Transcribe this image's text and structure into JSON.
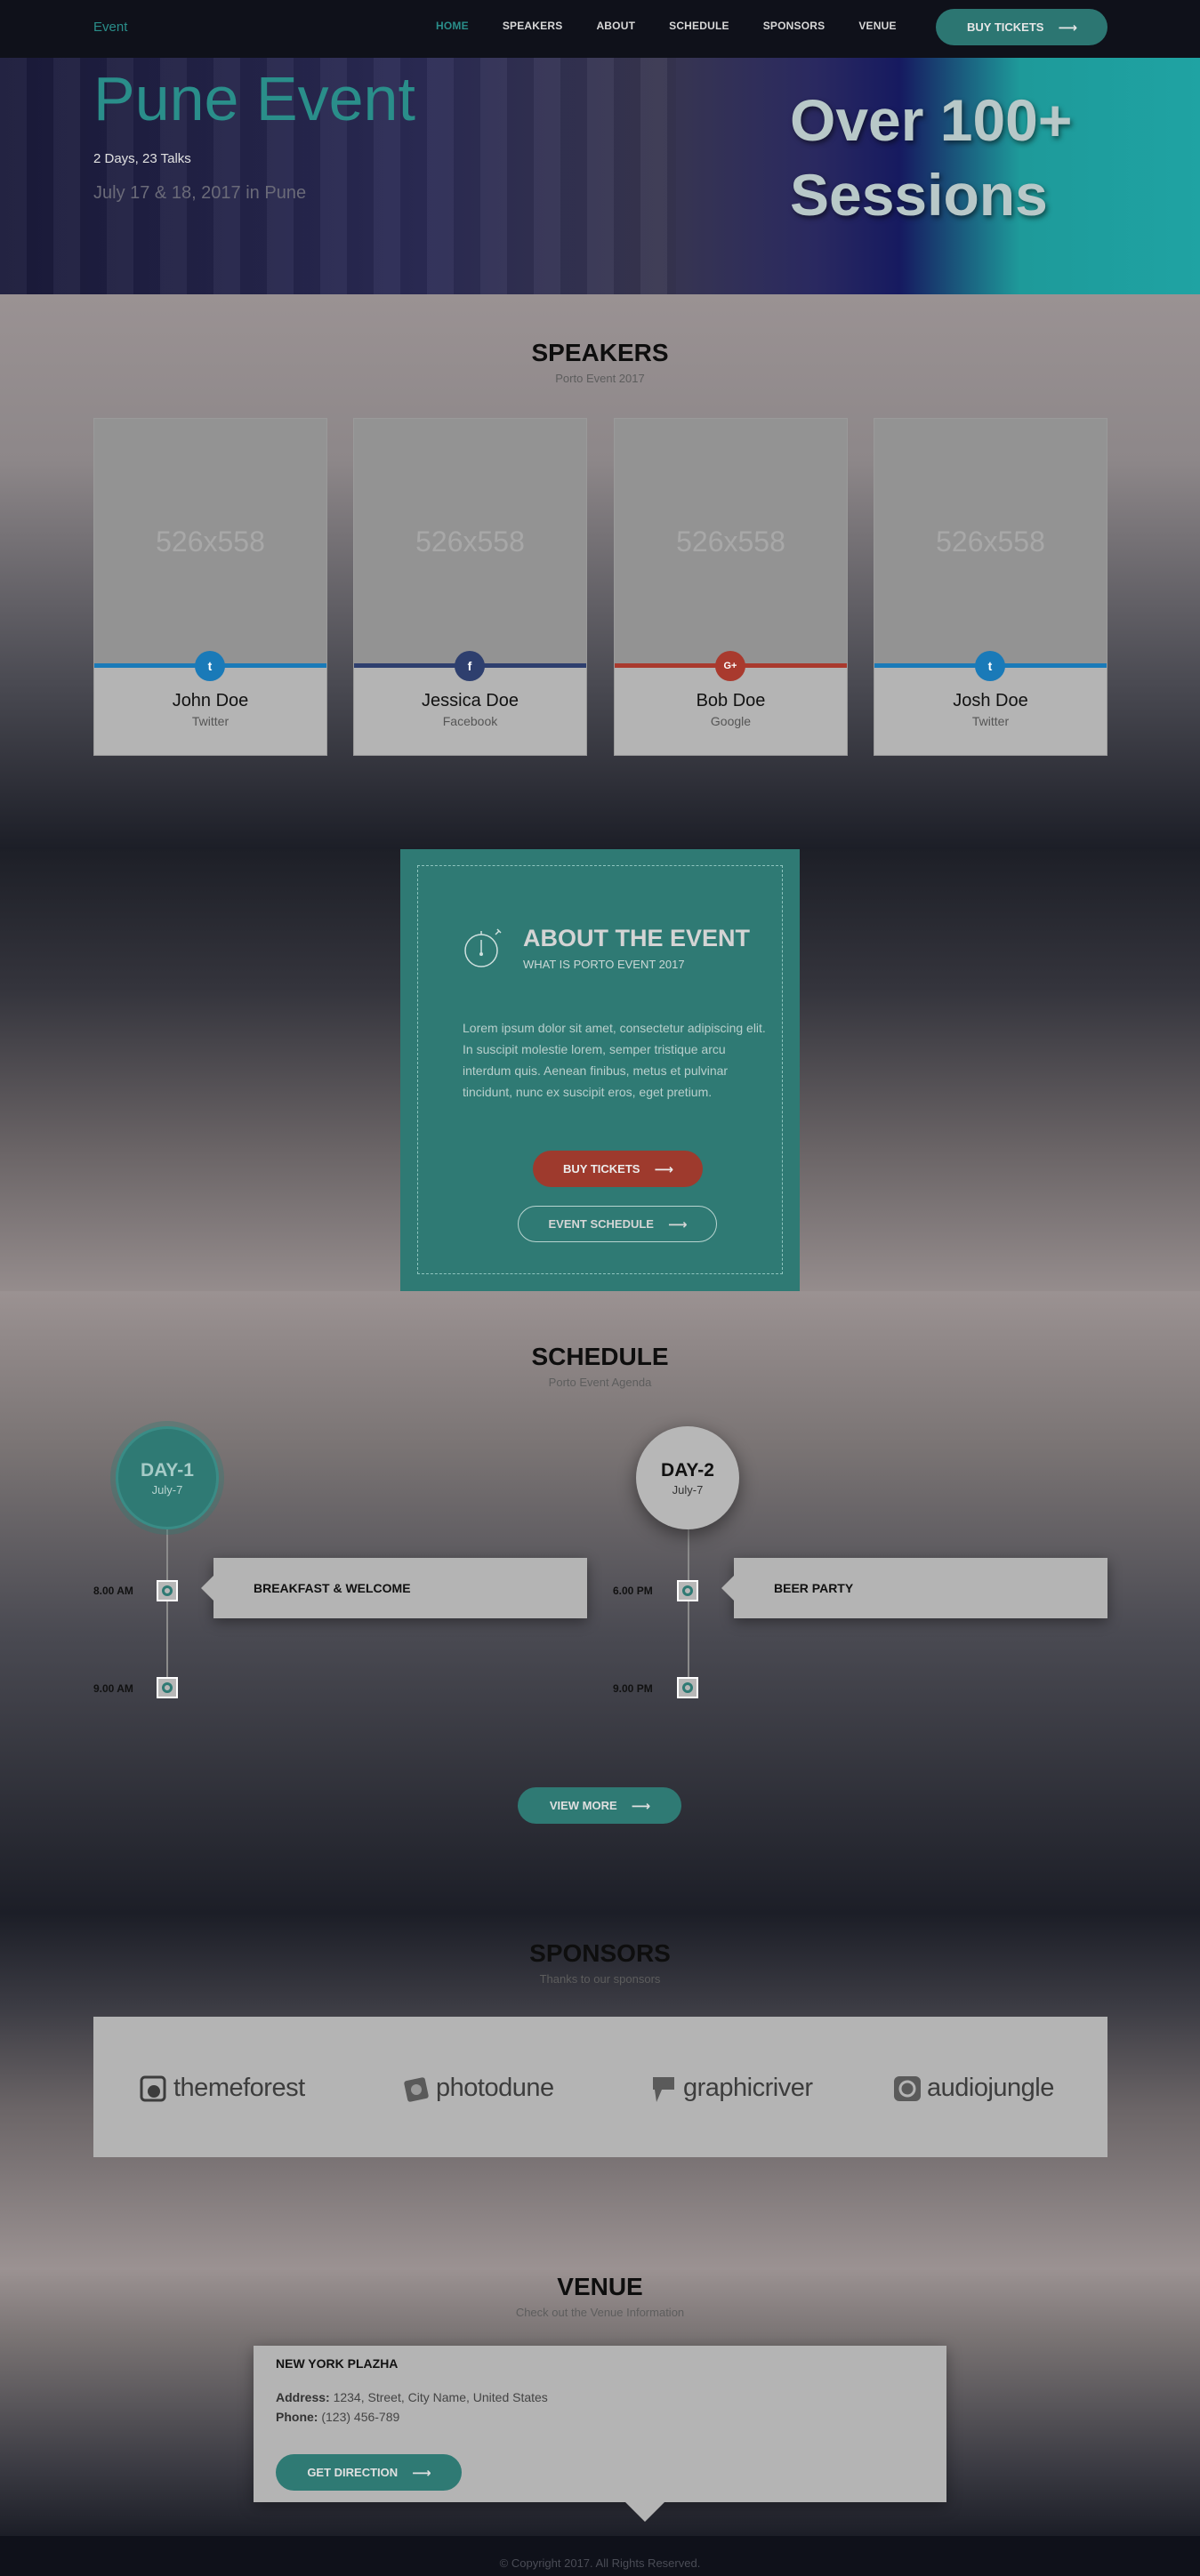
{
  "header": {
    "logo": "Event",
    "nav": [
      {
        "label": "HOME",
        "active": true
      },
      {
        "label": "SPEAKERS",
        "active": false
      },
      {
        "label": "ABOUT",
        "active": false
      },
      {
        "label": "SCHEDULE",
        "active": false
      },
      {
        "label": "SPONSORS",
        "active": false
      },
      {
        "label": "VENUE",
        "active": false
      }
    ],
    "buy_tickets": "BUY TICKETS"
  },
  "hero": {
    "title": "Pune Event",
    "subtitle": "2 Days, 23 Talks",
    "date": "July 17 & 18, 2017 in Pune",
    "banner_line1": "Over 100+",
    "banner_line2": "Sessions"
  },
  "speakers": {
    "title": "SPEAKERS",
    "subtitle": "Porto Event 2017",
    "cards": [
      {
        "image_text": "526x558",
        "name": "John Doe",
        "role": "Twitter",
        "icon": "twitter-icon",
        "glyph": "t",
        "color": "#1a7ab8"
      },
      {
        "image_text": "526x558",
        "name": "Jessica Doe",
        "role": "Facebook",
        "icon": "facebook-icon",
        "glyph": "f",
        "color": "#2e3f6e"
      },
      {
        "image_text": "526x558",
        "name": "Bob Doe",
        "role": "Google",
        "icon": "google-plus-icon",
        "glyph": "G+",
        "color": "#a93a2e"
      },
      {
        "image_text": "526x558",
        "name": "Josh Doe",
        "role": "Twitter",
        "icon": "twitter-icon",
        "glyph": "t",
        "color": "#1a7ab8"
      }
    ]
  },
  "about": {
    "title": "ABOUT THE EVENT",
    "subtitle": "WHAT IS PORTO EVENT 2017",
    "text": "Lorem ipsum dolor sit amet, consectetur adipiscing elit. In suscipit molestie lorem, semper tristique arcu interdum quis. Aenean finibus, metus et pulvinar tincidunt, nunc ex suscipit eros, eget pretium.",
    "buy_tickets": "BUY TICKETS",
    "event_schedule": "EVENT SCHEDULE"
  },
  "schedule": {
    "title": "SCHEDULE",
    "subtitle": "Porto Event Agenda",
    "days": [
      {
        "name": "DAY-1",
        "date": "July-7",
        "slots": [
          {
            "time": "8.00 AM",
            "event": "BREAKFAST & WELCOME"
          },
          {
            "time": "9.00 AM",
            "event": ""
          }
        ]
      },
      {
        "name": "DAY-2",
        "date": "July-7",
        "slots": [
          {
            "time": "6.00 PM",
            "event": "BEER PARTY"
          },
          {
            "time": "9.00 PM",
            "event": ""
          }
        ]
      }
    ],
    "view_more": "VIEW MORE"
  },
  "sponsors": {
    "title": "SPONSORS",
    "subtitle": "Thanks to our sponsors",
    "items": [
      {
        "name": "themeforest",
        "icon": "themeforest-logo-icon"
      },
      {
        "name": "photodune",
        "icon": "photodune-logo-icon"
      },
      {
        "name": "graphicriver",
        "icon": "graphicriver-logo-icon"
      },
      {
        "name": "audiojungle",
        "icon": "audiojungle-logo-icon"
      }
    ]
  },
  "venue": {
    "title": "VENUE",
    "subtitle": "Check out the Venue Information",
    "name": "NEW YORK PLAZHA",
    "address_label": "Address:",
    "address": "1234, Street, City Name, United States",
    "phone_label": "Phone:",
    "phone": "(123) 456-789",
    "direction": "GET DIRECTION"
  },
  "footer": {
    "copyright": "© Copyright 2017. All Rights Reserved."
  },
  "colors": {
    "accent": "#2f7a74",
    "accent_text": "#2a8e8a",
    "danger": "#9e3a2d"
  }
}
